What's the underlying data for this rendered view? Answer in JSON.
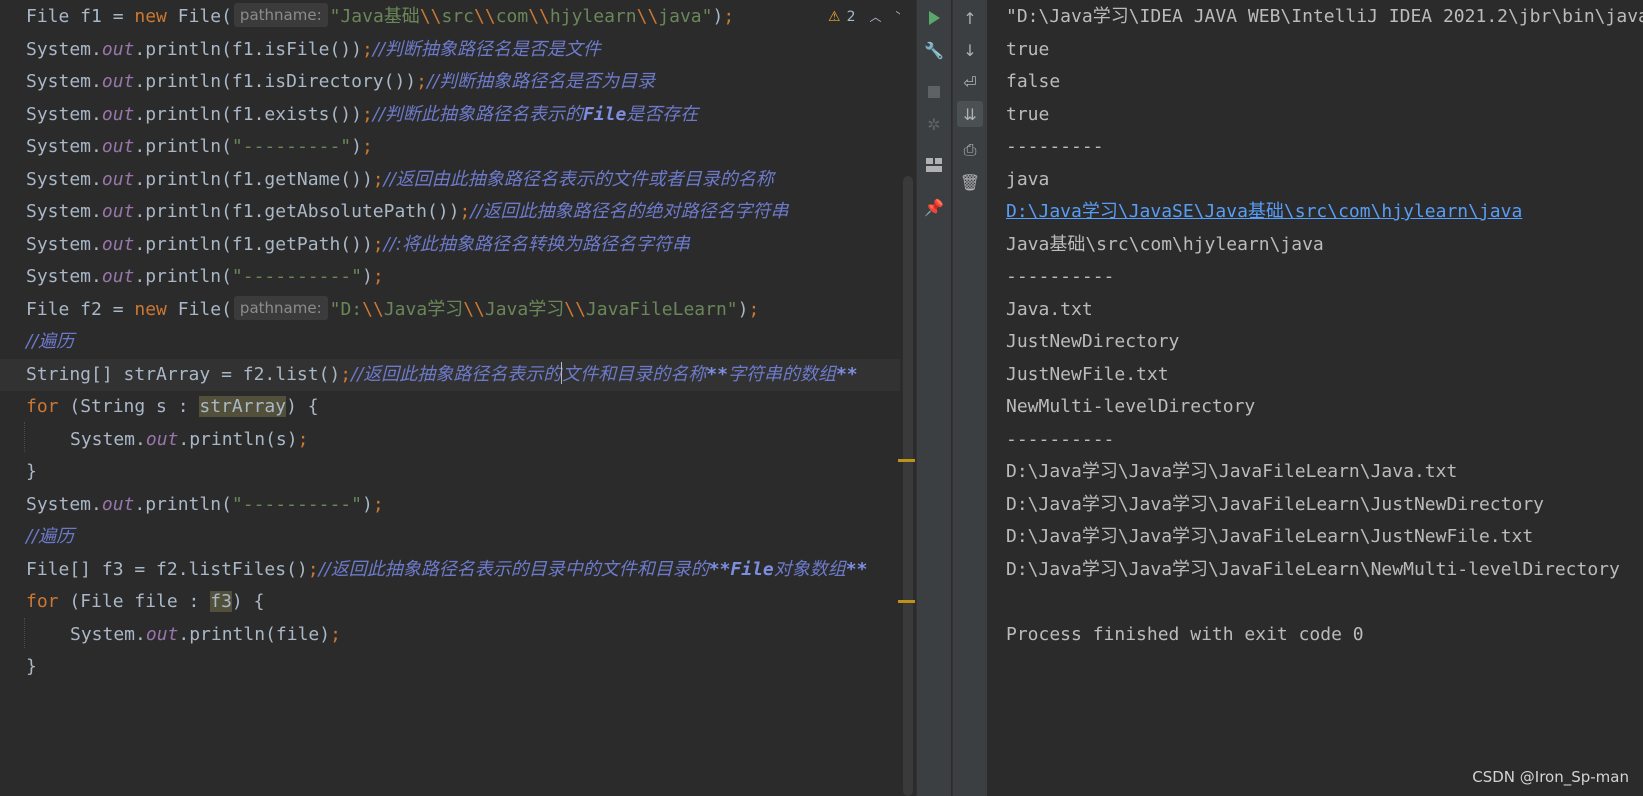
{
  "editor": {
    "inspection_count": "2",
    "lines": {
      "l1": {
        "a": "File f1 = ",
        "kw": "new",
        "b": " File(",
        "hint": "pathname:",
        "q1": "\"Java",
        "cjk": "基础",
        "e1": "\\\\",
        "s1": "src",
        "e2": "\\\\",
        "s2": "com",
        "e3": "\\\\",
        "s3": "hjylearn",
        "e4": "\\\\",
        "s4": "java\"",
        "c": ")",
        "semi": ";"
      },
      "l2": {
        "a": "System.",
        "f": "out",
        "b": ".println(f1.isFile())",
        "semi": ";",
        "cm": "//判断抽象路径名是否是文件"
      },
      "l3": {
        "a": "System.",
        "f": "out",
        "b": ".println(f1.isDirectory())",
        "semi": ";",
        "cm": "//判断抽象路径名是否为目录"
      },
      "l4": {
        "a": "System.",
        "f": "out",
        "b": ".println(f1.exists())",
        "semi": ";",
        "cm1": "//判断此抽象路径名表示的",
        "cmb": "File",
        "cm2": "是否存在"
      },
      "l5": {
        "a": "System.",
        "f": "out",
        "b": ".println(",
        "s": "\"---------\"",
        "c": ")",
        "semi": ";"
      },
      "l6": {
        "a": "System.",
        "f": "out",
        "b": ".println(f1.getName())",
        "semi": ";",
        "cm": "//返回由此抽象路径名表示的文件或者目录的名称"
      },
      "l7": {
        "a": "System.",
        "f": "out",
        "b": ".println(f1.getAbsolutePath())",
        "semi": ";",
        "cm": "//返回此抽象路径名的绝对路径名字符串"
      },
      "l8": {
        "a": "System.",
        "f": "out",
        "b": ".println(f1.getPath())",
        "semi": ";",
        "cm": "//:将此抽象路径名转换为路径名字符串"
      },
      "l9": {
        "a": "System.",
        "f": "out",
        "b": ".println(",
        "s": "\"----------\"",
        "c": ")",
        "semi": ";"
      },
      "l10": {
        "a": "File f2 = ",
        "kw": "new",
        "b": " File(",
        "hint": "pathname:",
        "q1": "\"D:",
        "e1": "\\\\",
        "s1": "Java",
        "cj1": "学习",
        "e2": "\\\\",
        "s2": "Java",
        "cj2": "学习",
        "e3": "\\\\",
        "s3": "JavaFileLearn\"",
        "c": ")",
        "semi": ";"
      },
      "l11": {
        "cm": "//遍历"
      },
      "l12": {
        "a": "String[] strArray = f2.list()",
        "semi": ";",
        "cm1": "//返回此抽象路径名表示的",
        "cm2": "文件和目录的名称",
        "cmb": "**",
        "cm3": "字符串的数组",
        "cmb2": "**"
      },
      "l13": {
        "kw": "for",
        "a": " (String s : ",
        "v": "strArray",
        "b": ") {"
      },
      "l14": {
        "a": "System.",
        "f": "out",
        "b": ".println(s)",
        "semi": ";"
      },
      "l15": {
        "a": "}"
      },
      "l16": {
        "a": "System.",
        "f": "out",
        "b": ".println(",
        "s": "\"----------\"",
        "c": ")",
        "semi": ";"
      },
      "l17": {
        "cm": "//遍历"
      },
      "l18": {
        "a": "File[] f3 = f2.listFiles()",
        "semi": ";",
        "cm1": "//返回此抽象路径名表示的目录中的文件和目录的",
        "cmb": "**File",
        "cm2": "对象数组",
        "cmb2": "**"
      },
      "l19": {
        "kw": "for",
        "a": " (File file : ",
        "v": "f3",
        "b": ") {"
      },
      "l20": {
        "a": "System.",
        "f": "out",
        "b": ".println(file)",
        "semi": ";"
      },
      "l21": {
        "a": "}"
      }
    }
  },
  "console": {
    "lines": [
      "\"D:\\Java学习\\IDEA JAVA WEB\\IntelliJ IDEA 2021.2\\jbr\\bin\\java",
      "true",
      "false",
      "true",
      "---------",
      "java",
      "D:\\Java学习\\JavaSE\\Java基础\\src\\com\\hjylearn\\java",
      "Java基础\\src\\com\\hjylearn\\java",
      "----------",
      "Java.txt",
      "JustNewDirectory",
      "JustNewFile.txt",
      "NewMulti-levelDirectory",
      "----------",
      "D:\\Java学习\\Java学习\\JavaFileLearn\\Java.txt",
      "D:\\Java学习\\Java学习\\JavaFileLearn\\JustNewDirectory",
      "D:\\Java学习\\Java学习\\JavaFileLearn\\JustNewFile.txt",
      "D:\\Java学习\\Java学习\\JavaFileLearn\\NewMulti-levelDirectory",
      "",
      "Process finished with exit code 0"
    ]
  },
  "watermark": "CSDN @Iron_Sp-man",
  "colors": {
    "background": "#2b2b2b",
    "keyword": "#cc7832",
    "string": "#6a8759",
    "field": "#9876aa",
    "comment": "#6c7ac9",
    "link": "#589df6",
    "warning": "#f0a732"
  },
  "icons": {
    "toolbar_left": [
      "run-icon",
      "wrench-icon",
      "stop-icon",
      "debug-icon",
      "layout-icon",
      "pin-icon"
    ],
    "toolbar_right": [
      "arrow-up-icon",
      "arrow-down-icon",
      "soft-wrap-icon",
      "scroll-to-end-icon",
      "print-icon",
      "trash-icon"
    ]
  }
}
